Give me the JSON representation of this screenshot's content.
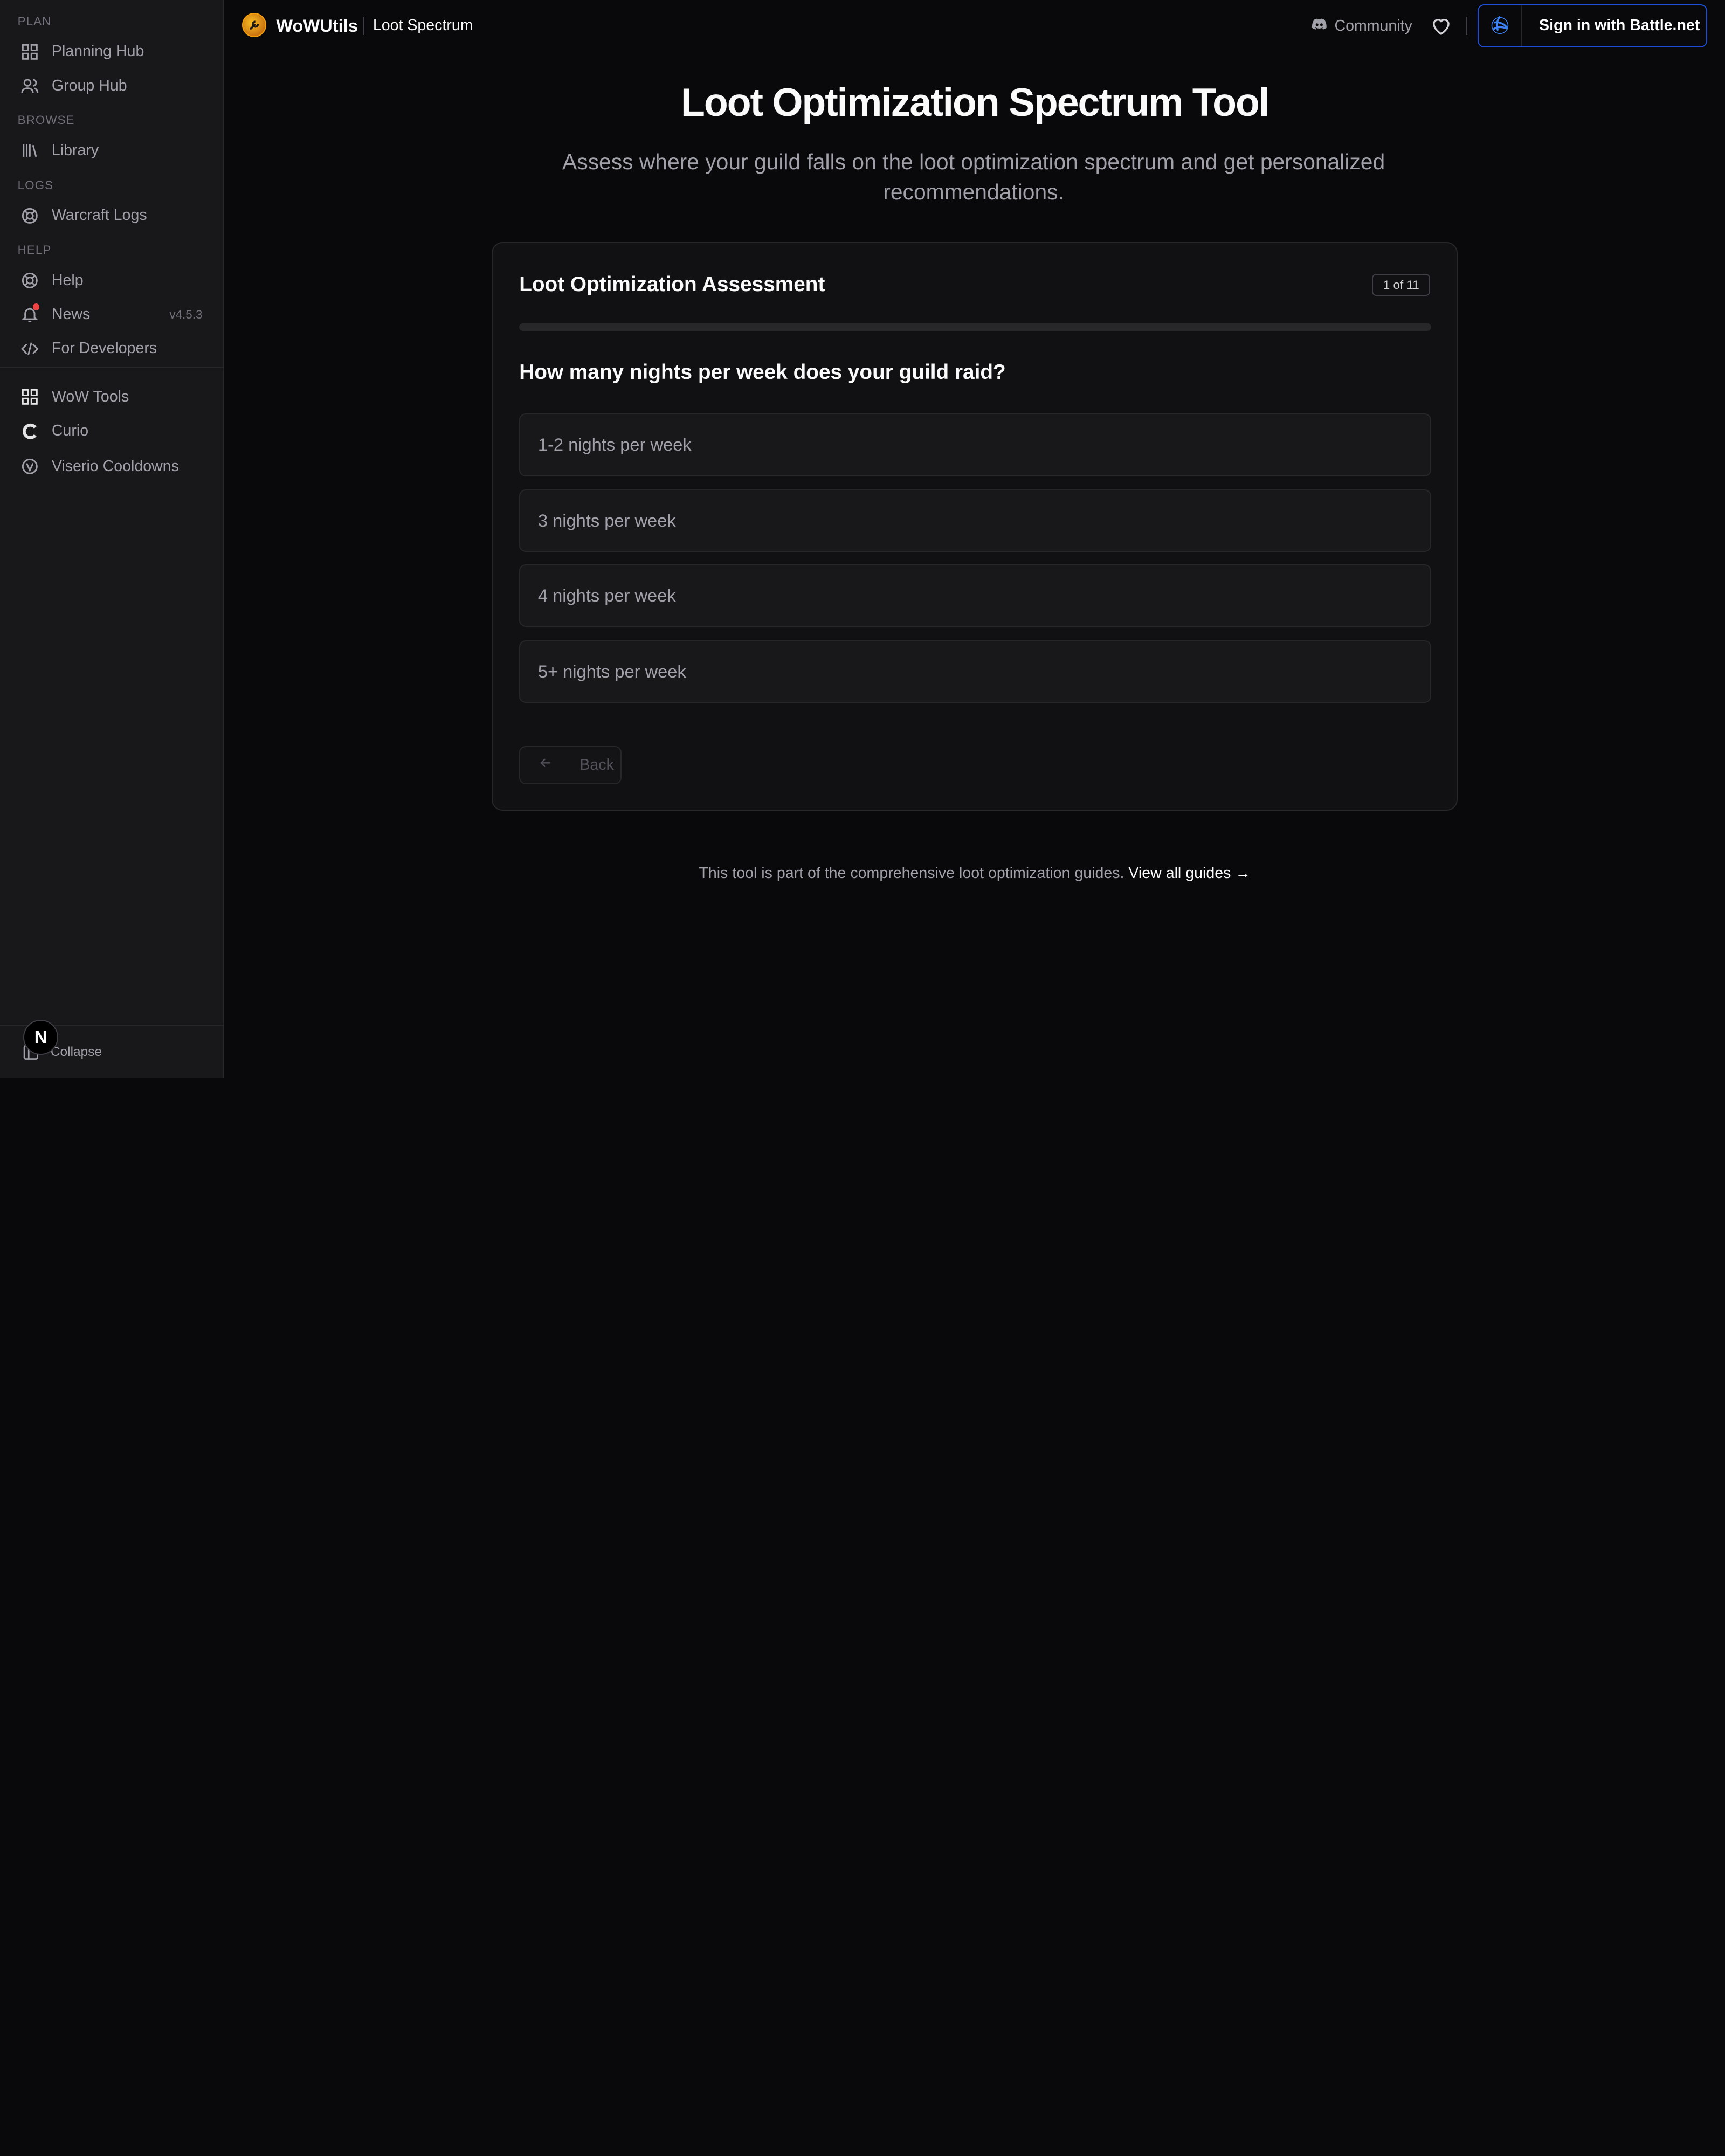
{
  "sidebar": {
    "sections": [
      "PLAN",
      "BROWSE",
      "LOGS",
      "HELP"
    ],
    "items": [
      {
        "label": "Planning Hub",
        "icon": "grid-icon"
      },
      {
        "label": "Group Hub",
        "icon": "users-icon"
      },
      {
        "label": "Library",
        "icon": "library-icon"
      },
      {
        "label": "Warcraft Logs",
        "icon": "warcraft-logs-icon"
      },
      {
        "label": "Help",
        "icon": "lifebuoy-icon"
      },
      {
        "label": "News",
        "icon": "bell-icon"
      },
      {
        "label": "For Developers",
        "icon": "code-icon"
      },
      {
        "label": "WoW Tools",
        "icon": "grid-icon"
      },
      {
        "label": "Curio",
        "icon": "curio-icon"
      },
      {
        "label": "Viserio Cooldowns",
        "icon": "viserio-icon"
      }
    ],
    "version": "v4.5.3",
    "collapse_label": "Collapse",
    "badge": "N"
  },
  "header": {
    "brand": "WoWUtils",
    "breadcrumb": "Loot Spectrum",
    "community": "Community",
    "signin": "Sign in with Battle.net"
  },
  "main": {
    "title": "Loot Optimization Spectrum Tool",
    "subtitle": "Assess where your guild falls on the loot optimization spectrum and get personalized recommendations."
  },
  "card": {
    "title": "Loot Optimization Assessment",
    "step": "1 of 11",
    "progress": 0.0,
    "question": "How many nights per week does your guild raid?",
    "options": [
      "1-2 nights per week",
      "3 nights per week",
      "4 nights per week",
      "5+ nights per week"
    ],
    "back": "Back"
  },
  "footer": {
    "text": "This tool is part of the comprehensive loot optimization guides.",
    "link": "View all guides →"
  },
  "colors": {
    "accent": "#1d4ed8",
    "background": "#09090b",
    "panel": "#18181b"
  }
}
